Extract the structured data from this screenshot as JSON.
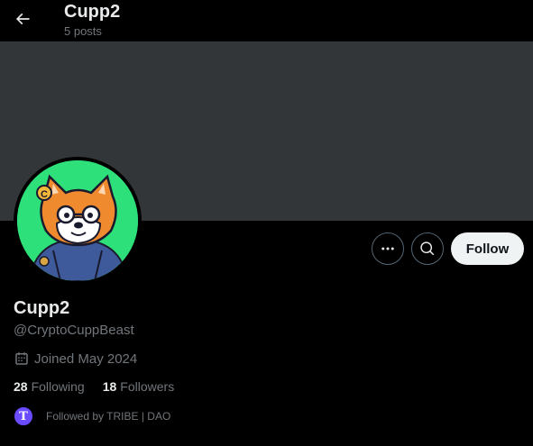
{
  "header": {
    "title": "Cupp2",
    "posts_count": "5 posts"
  },
  "actions": {
    "follow_label": "Follow"
  },
  "profile": {
    "display_name": "Cupp2",
    "handle": "@CryptoCuppBeast",
    "joined": "Joined May 2024",
    "following_count": "28",
    "following_label": "Following",
    "followers_count": "18",
    "followers_label": "Followers",
    "followed_by": "Followed by TRIBE | DAO",
    "mini_avatar_letter": "T"
  },
  "colors": {
    "background": "#000000",
    "banner": "#333639",
    "avatar_bg": "#2de07a",
    "muted_text": "#71767b",
    "follow_button_bg": "#eff3f4"
  },
  "icons": {
    "back": "arrow-left-icon",
    "more": "more-dots-icon",
    "search": "search-icon",
    "calendar": "calendar-icon"
  }
}
